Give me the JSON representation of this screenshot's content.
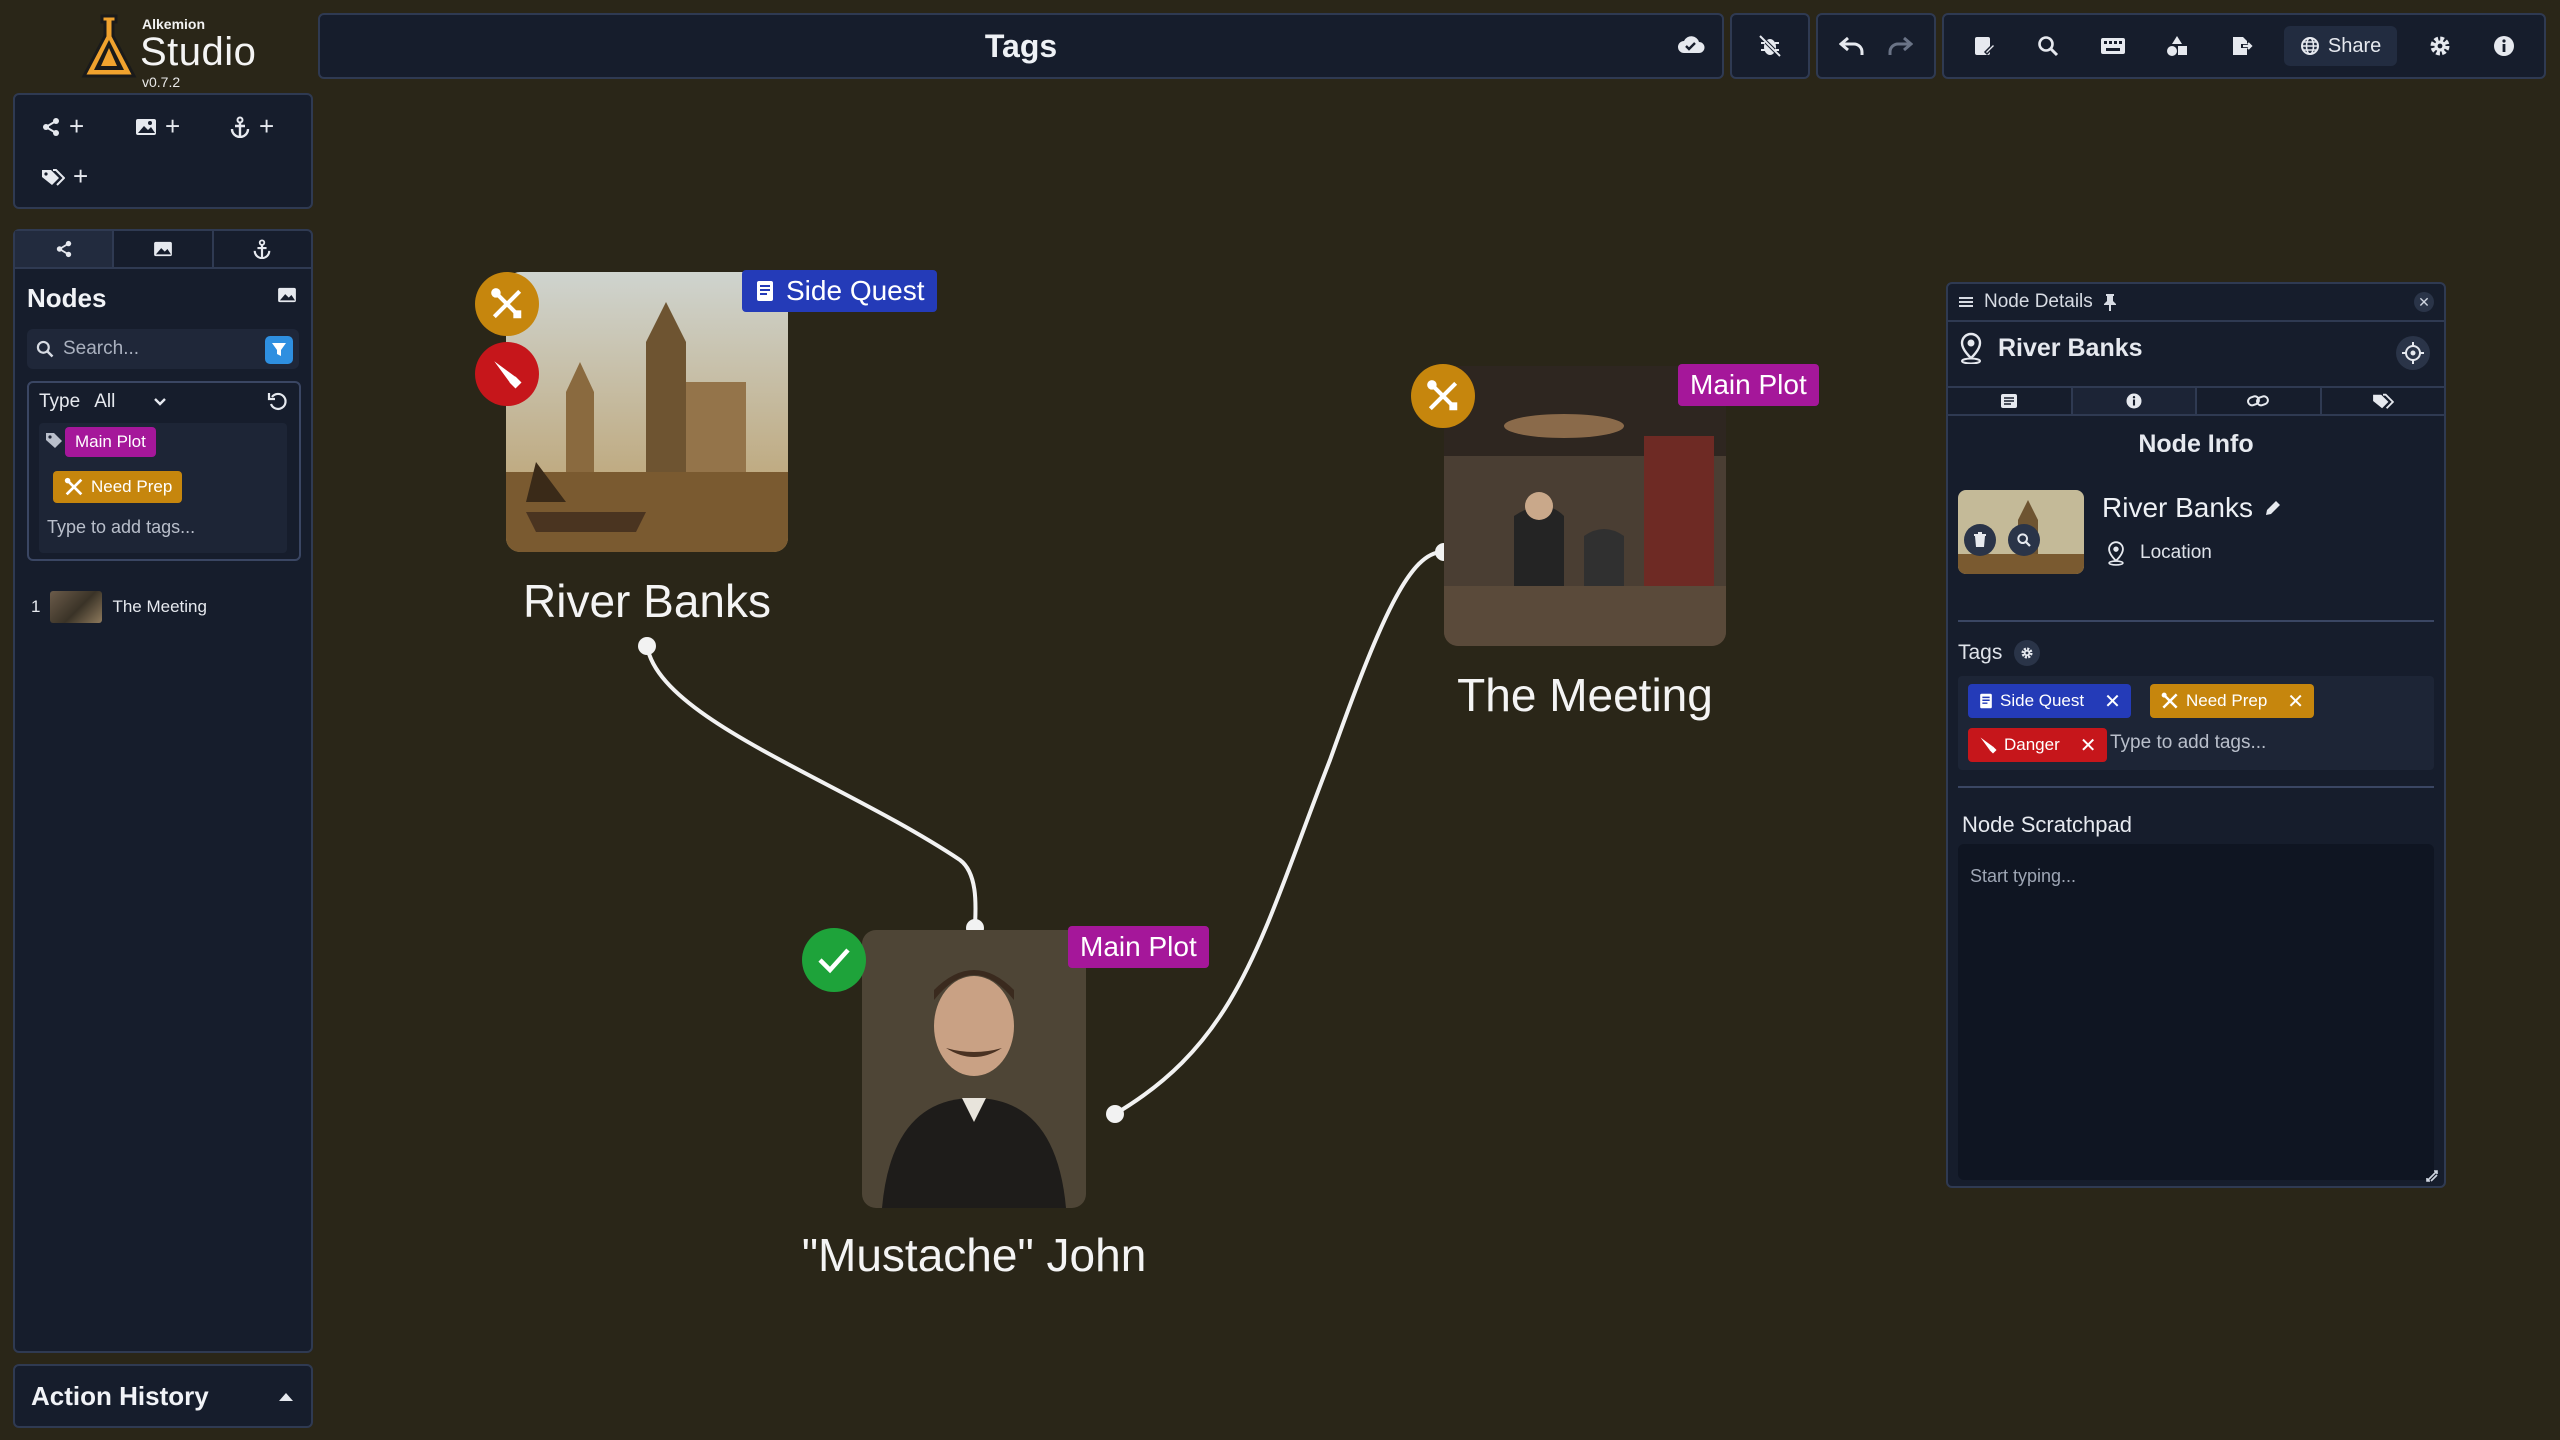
{
  "logo": {
    "small": "Alkemion",
    "big": "Studio",
    "version": "v0.7.2"
  },
  "toolbar": {
    "title": "Tags",
    "share_label": "Share"
  },
  "nodes_panel": {
    "heading": "Nodes",
    "search_placeholder": "Search...",
    "type_label": "Type",
    "type_value": "All",
    "filter_tags": [
      "Main Plot",
      "Need Prep"
    ],
    "tag_input_placeholder": "Type to add tags...",
    "list": [
      {
        "index": "1",
        "name": "The Meeting"
      }
    ]
  },
  "history": {
    "title": "Action History"
  },
  "canvas": {
    "nodes": [
      {
        "label": "River Banks",
        "tag": "Side Quest",
        "badges": [
          "need-prep",
          "danger"
        ]
      },
      {
        "label": "The Meeting",
        "tag": "Main Plot",
        "badges": [
          "need-prep"
        ]
      },
      {
        "label": "\"Mustache\" John",
        "tag": "Main Plot",
        "badges": [
          "done"
        ]
      }
    ]
  },
  "details": {
    "header": "Node Details",
    "node_name": "River Banks",
    "section_title": "Node Info",
    "info_name": "River Banks",
    "info_type": "Location",
    "tags_label": "Tags",
    "tags": [
      {
        "label": "Side Quest",
        "color": "#243bb8"
      },
      {
        "label": "Need Prep",
        "color": "#c6860d"
      },
      {
        "label": "Danger",
        "color": "#c6161b"
      }
    ],
    "tag_input_placeholder": "Type to add tags...",
    "scratchpad_label": "Node Scratchpad",
    "scratchpad_placeholder": "Start typing..."
  },
  "colors": {
    "background": "#2a2618",
    "panel": "#161d2c",
    "main_plot": "#a5179a",
    "need_prep": "#c6860d",
    "side_quest": "#243bb8",
    "danger": "#c6161b",
    "done": "#1ea33a"
  }
}
